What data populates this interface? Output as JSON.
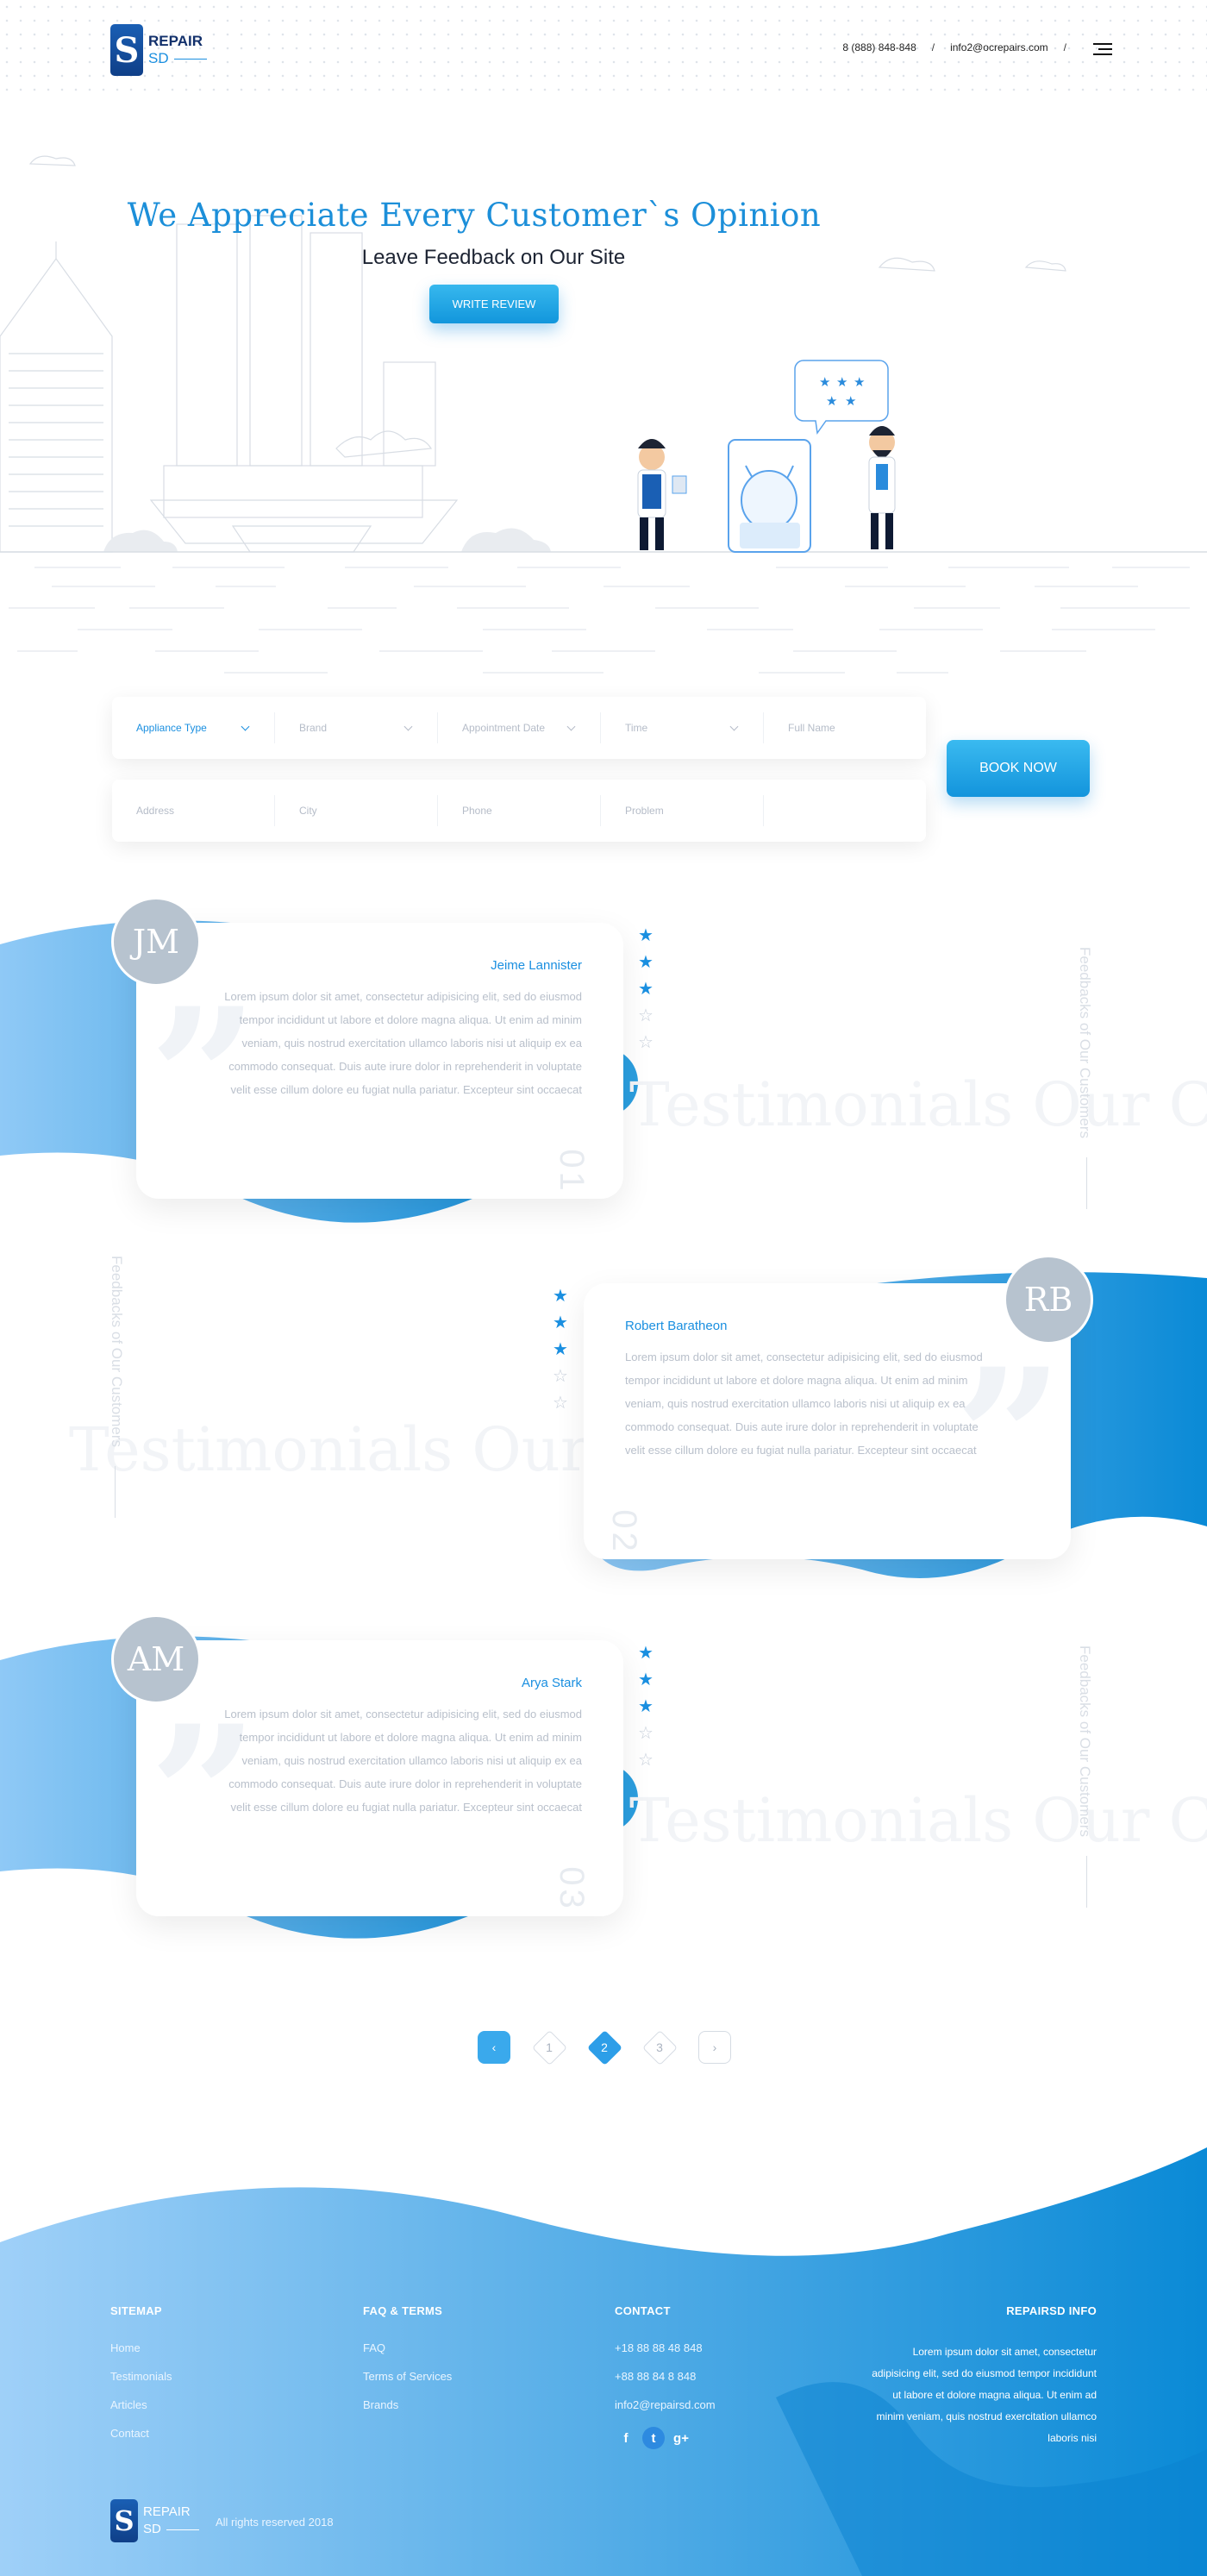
{
  "colors": {
    "accent": "#1a8fe0",
    "accent_light": "#37b8ee",
    "footer_gradient_start": "#8fc9f6",
    "footer_gradient_end": "#0a8ad6"
  },
  "header": {
    "logo": {
      "repair": "REPAIR",
      "sd": "SD"
    },
    "phone": "8 (888) 848-848",
    "email": "info2@ocrepairs.com",
    "separator": "/",
    "menu_icon": "hamburger-icon"
  },
  "hero": {
    "title": "We Appreciate Every Customer`s Opinion",
    "subtitle": "Leave Feedback on Our Site",
    "button_label": "WRITE REVIEW",
    "speech_bubble_stars": 5
  },
  "booking": {
    "row1": [
      {
        "label": "Appliance Type",
        "dropdown": true,
        "active": true
      },
      {
        "label": "Brand",
        "dropdown": true
      },
      {
        "label": "Appointment Date",
        "dropdown": true
      },
      {
        "label": "Time",
        "dropdown": true
      },
      {
        "label": "Full Name",
        "dropdown": false
      }
    ],
    "row2": [
      {
        "label": "Address"
      },
      {
        "label": "City"
      },
      {
        "label": "Phone"
      },
      {
        "label": "Problem"
      }
    ],
    "button_label": "BOOK NOW"
  },
  "testimonials": {
    "side_label": "Feedbacks of Our Customers",
    "ghost_text": "Testimonials Our C",
    "items": [
      {
        "initials": "JM",
        "name": "Jeime Lannister",
        "number": "01",
        "rating": 3,
        "max_rating": 5,
        "text": "Lorem ipsum dolor sit amet, consectetur adipisicing elit, sed do eiusmod tempor incididunt ut labore et dolore magna aliqua. Ut enim ad minim veniam, quis nostrud exercitation ullamco laboris nisi ut aliquip ex ea commodo consequat. Duis aute irure dolor in reprehenderit in voluptate velit esse cillum dolore eu fugiat nulla pariatur. Excepteur sint occaecat"
      },
      {
        "initials": "RB",
        "name": "Robert Baratheon",
        "number": "02",
        "rating": 3,
        "max_rating": 5,
        "text": "Lorem ipsum dolor sit amet, consectetur adipisicing elit, sed do eiusmod tempor incididunt ut labore et dolore magna aliqua. Ut enim ad minim veniam, quis nostrud exercitation ullamco laboris nisi ut aliquip ex ea commodo consequat. Duis aute irure dolor in reprehenderit in voluptate velit esse cillum dolore eu fugiat nulla pariatur. Excepteur sint occaecat"
      },
      {
        "initials": "AM",
        "name": "Arya Stark",
        "number": "03",
        "rating": 3,
        "max_rating": 5,
        "text": "Lorem ipsum dolor sit amet, consectetur adipisicing elit, sed do eiusmod tempor incididunt ut labore et dolore magna aliqua. Ut enim ad minim veniam, quis nostrud exercitation ullamco laboris nisi ut aliquip ex ea commodo consequat. Duis aute irure dolor in reprehenderit in voluptate velit esse cillum dolore eu fugiat nulla pariatur. Excepteur sint occaecat"
      }
    ]
  },
  "pagination": {
    "prev_icon": "chevron-left-icon",
    "next_icon": "chevron-right-icon",
    "pages": [
      "1",
      "2",
      "3"
    ],
    "current": "2"
  },
  "footer": {
    "sitemap": {
      "title": "SITEMAP",
      "links": [
        "Home",
        "Testimonials",
        "Articles",
        "Contact"
      ]
    },
    "faq": {
      "title": "FAQ & TERMS",
      "links": [
        "FAQ",
        "Terms of Services",
        "Brands"
      ]
    },
    "contact": {
      "title": "CONTACT",
      "lines": [
        "+18 88 88 48 848",
        "+88 88 84 8 848",
        "info2@repairsd.com"
      ],
      "socials": [
        "facebook-icon",
        "twitter-icon",
        "google-plus-icon"
      ]
    },
    "info": {
      "title": "REPAIRSD INFO",
      "text": "Lorem ipsum dolor sit amet, consectetur adipisicing elit, sed do eiusmod tempor incididunt ut labore et dolore magna aliqua. Ut enim ad minim veniam, quis nostrud exercitation ullamco laboris nisi"
    },
    "logo": {
      "repair": "REPAIR",
      "sd": "SD"
    },
    "copyright": "All rights reserved 2018"
  }
}
